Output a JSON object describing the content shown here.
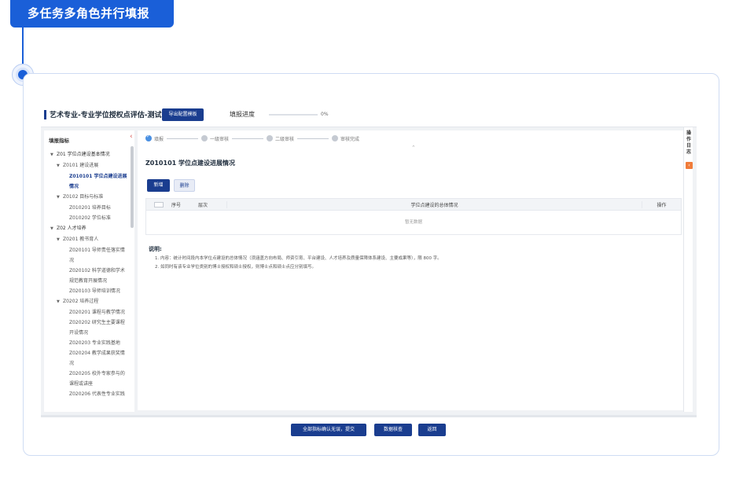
{
  "banner": {
    "title": "多任务多角色并行填报"
  },
  "app": {
    "title": "艺术专业-专业学位授权点评估-测试部",
    "export_button": "导出配置模板",
    "progress_label": "填报进度",
    "progress_percent": "0%",
    "progress_value": 0
  },
  "sidebar": {
    "collapse_icon": "chevron-left-icon",
    "heading": "填报指标",
    "items": [
      {
        "label": "Z01 学位点建设基本情况",
        "level": 1,
        "caret": "▼"
      },
      {
        "label": "Z0101 建设进展",
        "level": 2,
        "caret": "▼"
      },
      {
        "label": "Z010101 学位点建设进展情况",
        "level": 3,
        "active": true
      },
      {
        "label": "Z0102 目标与标准",
        "level": 2,
        "caret": "▼"
      },
      {
        "label": "Z010201 培养目标",
        "level": 3
      },
      {
        "label": "Z010202 学位标准",
        "level": 3
      },
      {
        "label": "Z02 人才培养",
        "level": 1,
        "caret": "▼"
      },
      {
        "label": "Z0201 教书育人",
        "level": 2,
        "caret": "▼"
      },
      {
        "label": "Z020101 导师责任落实情况",
        "level": 3
      },
      {
        "label": "Z020102 科学道德和学术规范教育开展情况",
        "level": 3
      },
      {
        "label": "Z020103 导师培训情况",
        "level": 3
      },
      {
        "label": "Z0202 培养过程",
        "level": 2,
        "caret": "▼"
      },
      {
        "label": "Z020201 课程与教学情况",
        "level": 3
      },
      {
        "label": "Z020202 研究生主要课程开设情况",
        "level": 3
      },
      {
        "label": "Z020203 专业实践基地",
        "level": 3
      },
      {
        "label": "Z020204 教学成果获奖情况",
        "level": 3
      },
      {
        "label": "Z020205 校外专家参与的课程或讲座",
        "level": 3
      },
      {
        "label": "Z020206 代表性专业实践",
        "level": 3
      }
    ]
  },
  "steps": [
    {
      "label": "填报",
      "done": true
    },
    {
      "label": "一级审核",
      "done": false
    },
    {
      "label": "二级审核",
      "done": false
    },
    {
      "label": "审核完成",
      "done": false
    }
  ],
  "main": {
    "section_title": "Z010101 学位点建设进展情况",
    "add_button": "新增",
    "delete_button": "删除",
    "table": {
      "headers": {
        "seq": "序号",
        "level": "层次",
        "overall": "学位点建设的总体情况",
        "op": "操作"
      },
      "empty_text": "暂无数据"
    },
    "notes_title": "说明:",
    "notes": [
      "1. 内容：统计时间段内本学位点建设的总体情况（须涵盖方向布局、师资引育、平台建设、人才培养及质量保障体系建设、主要成果等），限 800 字。",
      "2. 如同时有该专业学位类别的博士授权和硕士授权，则博士点和硕士点应分别填写。"
    ]
  },
  "rail": {
    "label": "操作日志",
    "button_icon": "chevron-left-icon"
  },
  "footer": {
    "confirm_button": "全部指标确认无误，提交",
    "check_button": "数据核查",
    "back_button": "返回"
  },
  "colors": {
    "primary": "#1a3d8f",
    "accent": "#1a5fd8",
    "warning": "#f07c3a"
  }
}
